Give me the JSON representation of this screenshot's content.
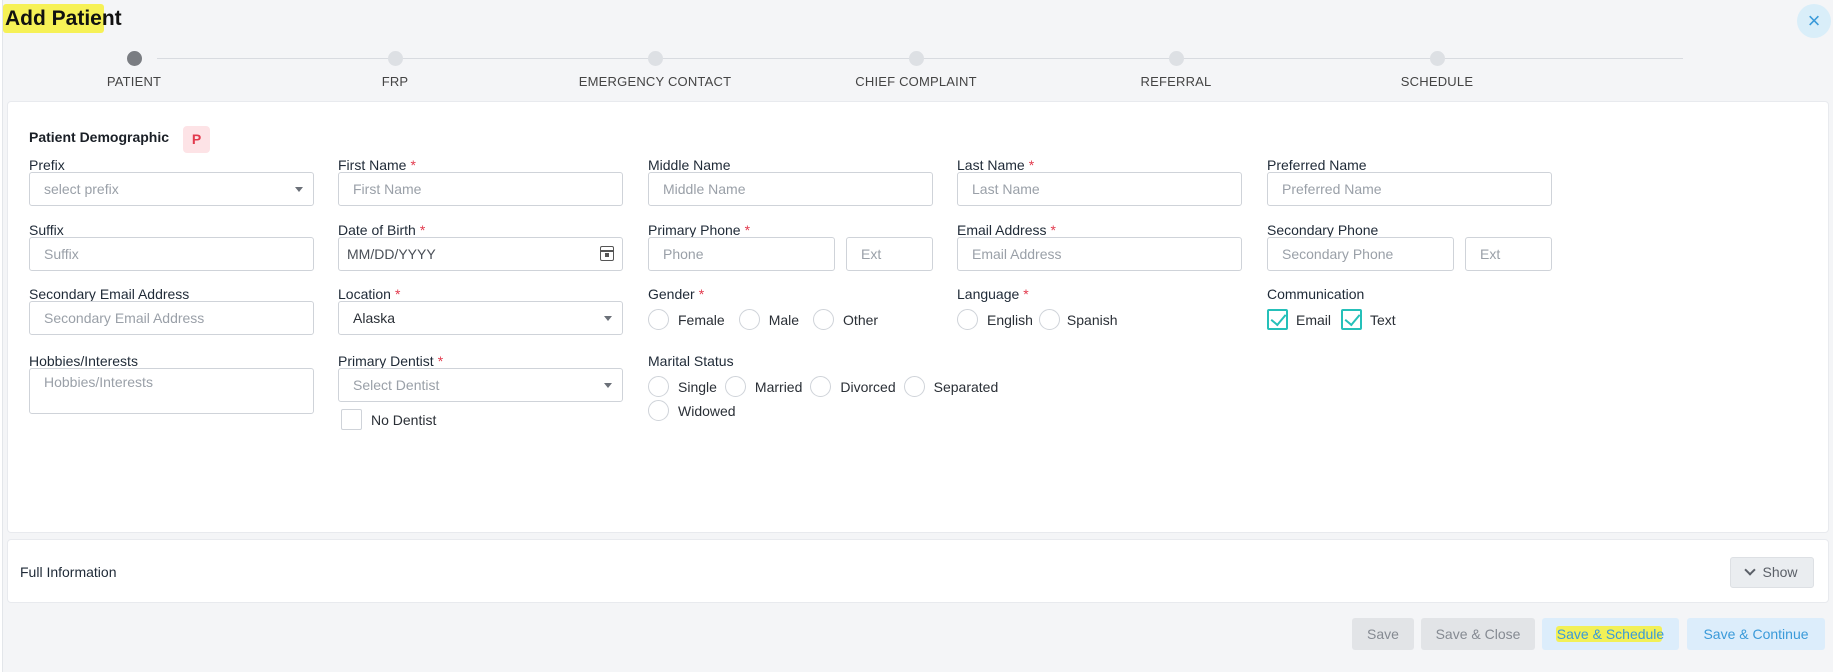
{
  "header": {
    "title": "Add Patient",
    "close_icon": "close-icon"
  },
  "stepper": {
    "steps": [
      {
        "label": "PATIENT",
        "active": true
      },
      {
        "label": "FRP",
        "active": false
      },
      {
        "label": "EMERGENCY CONTACT",
        "active": false
      },
      {
        "label": "CHIEF COMPLAINT",
        "active": false
      },
      {
        "label": "REFERRAL",
        "active": false
      },
      {
        "label": "SCHEDULE",
        "active": false
      }
    ]
  },
  "demographic": {
    "title": "Patient Demographic",
    "badge": "P",
    "fields": {
      "prefix": {
        "label": "Prefix",
        "placeholder": "select prefix"
      },
      "first_name": {
        "label": "First Name",
        "required": "*",
        "placeholder": "First Name"
      },
      "middle_name": {
        "label": "Middle Name",
        "placeholder": "Middle Name"
      },
      "last_name": {
        "label": "Last Name",
        "required": "*",
        "placeholder": "Last Name"
      },
      "preferred_name": {
        "label": "Preferred Name",
        "placeholder": "Preferred Name"
      },
      "suffix": {
        "label": "Suffix",
        "placeholder": "Suffix"
      },
      "dob": {
        "label": "Date of Birth",
        "required": "*",
        "placeholder": "MM/DD/YYYY"
      },
      "primary_phone": {
        "label": "Primary Phone",
        "required": "*",
        "placeholder": "Phone",
        "ext_placeholder": "Ext"
      },
      "email": {
        "label": "Email Address",
        "required": "*",
        "placeholder": "Email Address"
      },
      "secondary_phone": {
        "label": "Secondary Phone",
        "placeholder": "Secondary Phone",
        "ext_placeholder": "Ext"
      },
      "secondary_email": {
        "label": "Secondary Email Address",
        "placeholder": "Secondary Email Address"
      },
      "location": {
        "label": "Location",
        "required": "*",
        "value": "Alaska"
      },
      "gender": {
        "label": "Gender",
        "required": "*",
        "options": [
          "Female",
          "Male",
          "Other"
        ]
      },
      "language": {
        "label": "Language",
        "required": "*",
        "options": [
          "English",
          "Spanish"
        ]
      },
      "communication": {
        "label": "Communication",
        "options": [
          {
            "label": "Email",
            "checked": true
          },
          {
            "label": "Text",
            "checked": true
          }
        ]
      },
      "hobbies": {
        "label": "Hobbies/Interests",
        "placeholder": "Hobbies/Interests"
      },
      "primary_dentist": {
        "label": "Primary Dentist",
        "required": "*",
        "placeholder": "Select Dentist",
        "no_dentist_label": "No Dentist"
      },
      "marital_status": {
        "label": "Marital Status",
        "options": [
          "Single",
          "Married",
          "Divorced",
          "Separated",
          "Widowed"
        ]
      }
    }
  },
  "full_information": {
    "label": "Full Information",
    "show_label": "Show"
  },
  "footer": {
    "save": "Save",
    "save_close": "Save & Close",
    "save_schedule": "Save & Schedule",
    "save_continue": "Save & Continue"
  },
  "colors": {
    "accent": "#3a9ad9",
    "required": "#e23a4d",
    "check": "#25c0b9",
    "highlight": "#f6f03a"
  }
}
